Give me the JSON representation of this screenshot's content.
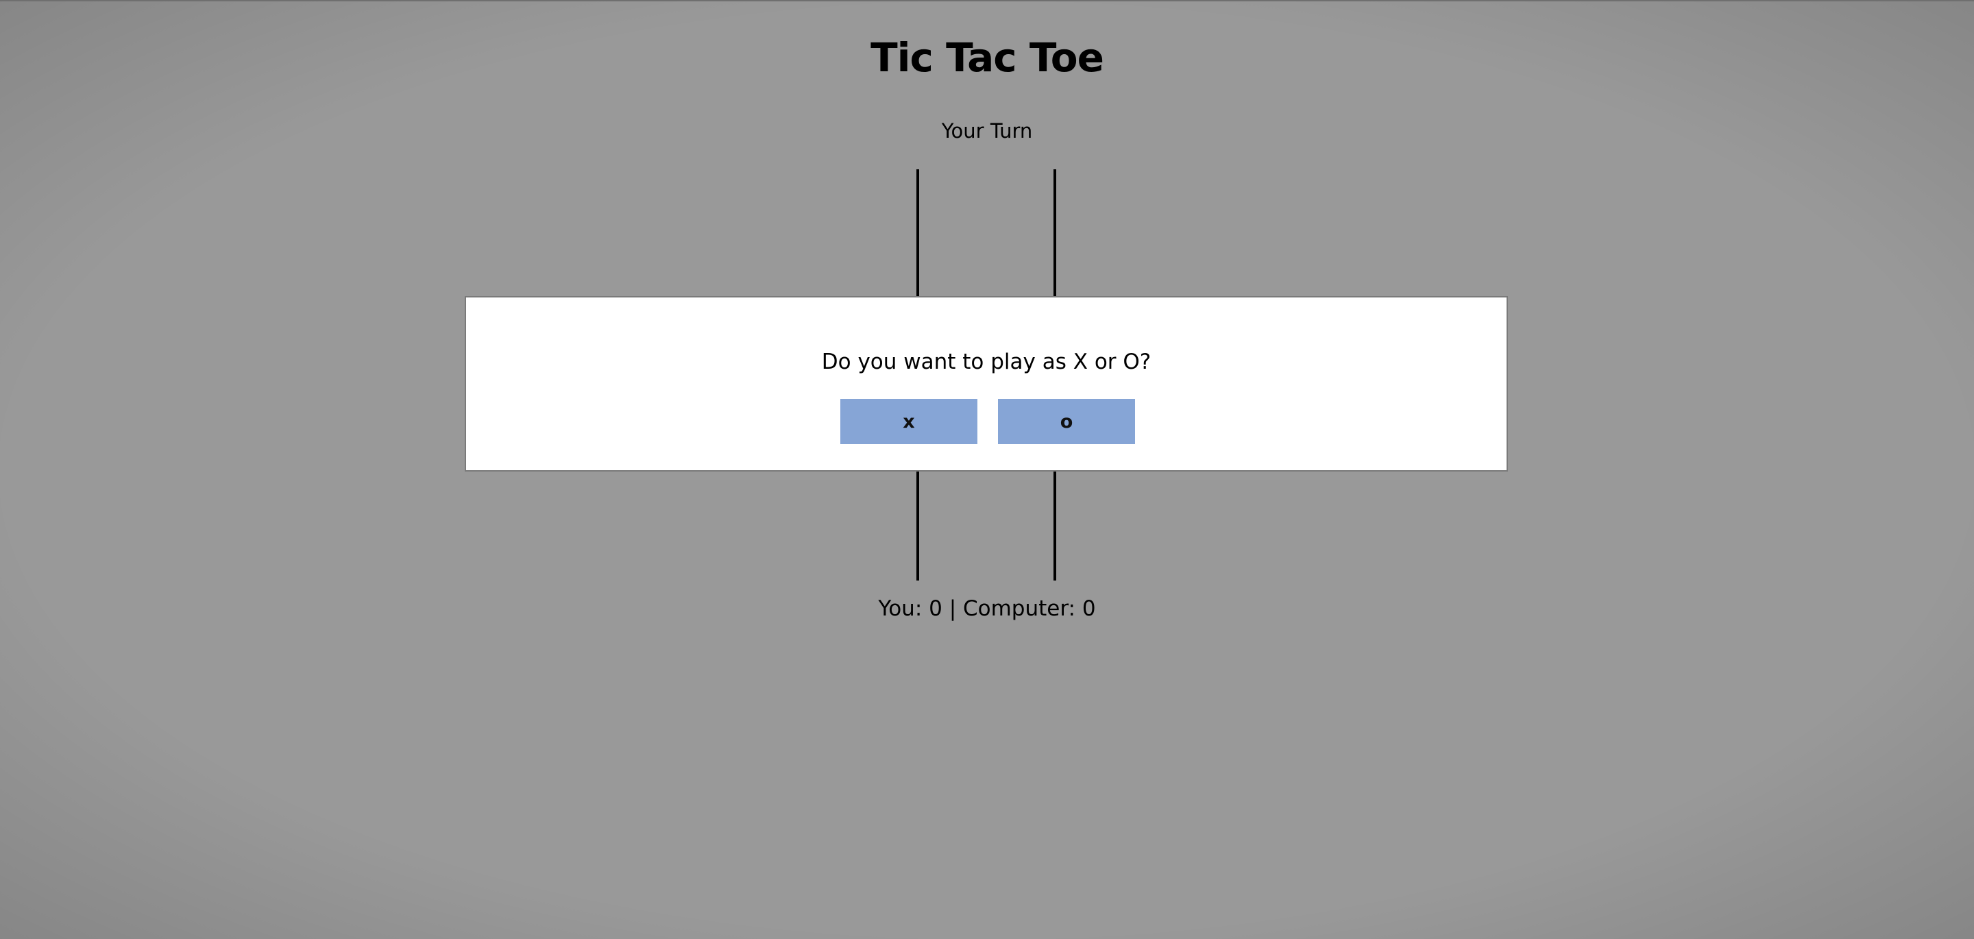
{
  "game": {
    "title": "Tic Tac Toe",
    "turn_status": "Your Turn",
    "score_text": "You: 0 | Computer: 0"
  },
  "modal": {
    "question": "Do you want to play as X or O?",
    "option_x_label": "x",
    "option_o_label": "o"
  },
  "colors": {
    "background": "#999999",
    "modal_background": "#ffffff",
    "button": "#86a5d6",
    "grid_line": "#000000"
  }
}
